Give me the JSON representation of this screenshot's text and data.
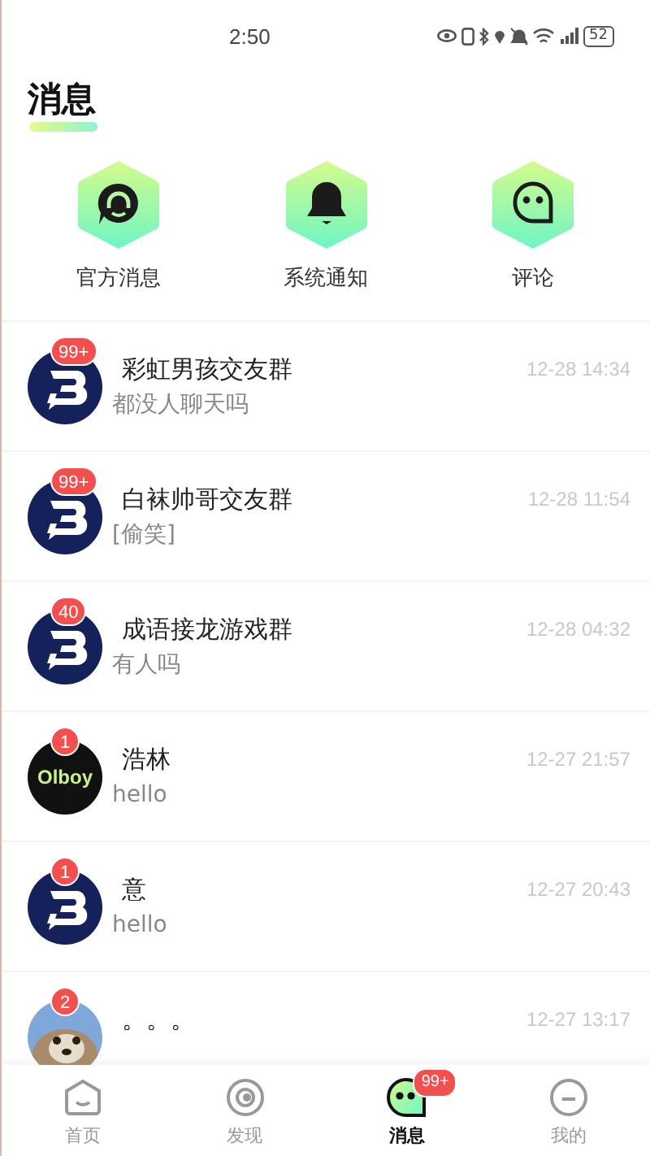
{
  "status_bar": {
    "time": "2:50",
    "battery": "52"
  },
  "title": "消息",
  "shortcuts": [
    {
      "kind": "official",
      "label": "官方消息"
    },
    {
      "kind": "notice",
      "label": "系统通知"
    },
    {
      "kind": "comment",
      "label": "评论"
    }
  ],
  "conversations": [
    {
      "avatar": {
        "kind": "logo"
      },
      "badge": "99+",
      "name": "彩虹男孩交友群",
      "message": "都没人聊天吗",
      "time": "12-28 14:34"
    },
    {
      "avatar": {
        "kind": "logo"
      },
      "badge": "99+",
      "name": "白袜帅哥交友群",
      "message": "[偷笑]",
      "time": "12-28 11:54"
    },
    {
      "avatar": {
        "kind": "logo"
      },
      "badge": "40",
      "name": "成语接龙游戏群",
      "message": "有人吗",
      "time": "12-28 04:32"
    },
    {
      "avatar": {
        "kind": "text",
        "text": "Olboy"
      },
      "badge": "1",
      "name": "浩林",
      "message": "hello",
      "time": "12-27 21:57"
    },
    {
      "avatar": {
        "kind": "logo"
      },
      "badge": "1",
      "name": "意",
      "message": "hello",
      "time": "12-27 20:43"
    },
    {
      "badge": "2",
      "name": "。。。",
      "time": "12-27 13:17"
    }
  ],
  "tabs": [
    {
      "kind": "home",
      "label": "首页",
      "selected": false
    },
    {
      "kind": "discover",
      "label": "发现",
      "selected": false
    },
    {
      "kind": "messages",
      "label": "消息",
      "selected": true,
      "badge": "99+"
    },
    {
      "kind": "me",
      "label": "我的",
      "selected": false
    }
  ]
}
